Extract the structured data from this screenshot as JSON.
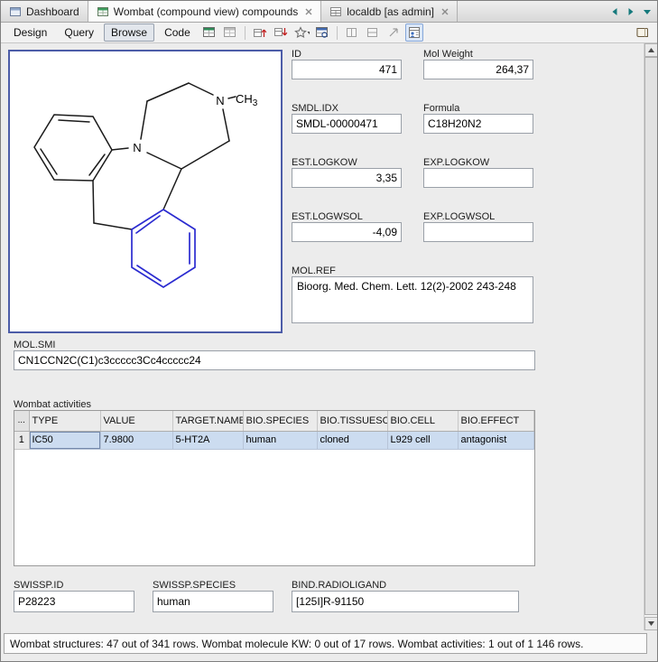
{
  "tabbar": {
    "tabs": [
      {
        "label": "Dashboard"
      },
      {
        "label": "Wombat (compound view) compounds"
      },
      {
        "label": "localdb [as admin]"
      }
    ],
    "control_icons": [
      "scroll-left",
      "scroll-right",
      "tab-list"
    ]
  },
  "toolbar": {
    "menus": [
      {
        "label": "Design"
      },
      {
        "label": "Query"
      },
      {
        "label": "Browse"
      },
      {
        "label": "Code"
      }
    ],
    "icons": [
      "new-grid-view",
      "grid-view",
      "sort-ascending",
      "sort-descending",
      "favorites",
      "table-search",
      "split-view-1",
      "split-view-2",
      "detach-view",
      "form-view",
      "library"
    ]
  },
  "structure": {
    "n1": "N",
    "n2": "N",
    "methyl_main": "CH",
    "methyl_sub": "3",
    "highlight_color": "#2b2bd0"
  },
  "form": {
    "id": {
      "label": "ID",
      "value": "471"
    },
    "mol_weight": {
      "label": "Mol Weight",
      "value": "264,37"
    },
    "smdl_idx": {
      "label": "SMDL.IDX",
      "value": "SMDL-00000471"
    },
    "formula": {
      "label": "Formula",
      "value": "C18H20N2"
    },
    "est_logkow": {
      "label": "EST.LOGKOW",
      "value": "3,35"
    },
    "exp_logkow": {
      "label": "EXP.LOGKOW",
      "value": ""
    },
    "est_logwsol": {
      "label": "EST.LOGWSOL",
      "value": "-4,09"
    },
    "exp_logwsol": {
      "label": "EXP.LOGWSOL",
      "value": ""
    },
    "mol_ref": {
      "label": "MOL.REF",
      "value": "Bioorg. Med. Chem. Lett. 12(2)-2002 243-248"
    },
    "mol_smi": {
      "label": "MOL.SMI",
      "value": "CN1CCN2C(C1)c3ccccc3Cc4ccccc24"
    },
    "swissp_id": {
      "label": "SWISSP.ID",
      "value": "P28223"
    },
    "swissp_species": {
      "label": "SWISSP.SPECIES",
      "value": "human"
    },
    "bind_radioligand": {
      "label": "BIND.RADIOLIGAND",
      "value": "[125I]R-91150"
    }
  },
  "activities": {
    "label": "Wombat activities",
    "corner": "...",
    "columns": [
      "TYPE",
      "VALUE",
      "TARGET.NAME",
      "BIO.SPECIES",
      "BIO.TISSUESOU",
      "BIO.CELL",
      "BIO.EFFECT"
    ],
    "rows": [
      {
        "num": "1",
        "cells": [
          "IC50",
          "7.9800",
          "5-HT2A",
          "human",
          "cloned",
          "L929 cell",
          "antagonist"
        ]
      }
    ]
  },
  "status_bar": {
    "text": "Wombat structures: 47 out of 341 rows. Wombat molecule KW: 0 out of 17 rows. Wombat activities: 1 out of 1 146 rows."
  }
}
